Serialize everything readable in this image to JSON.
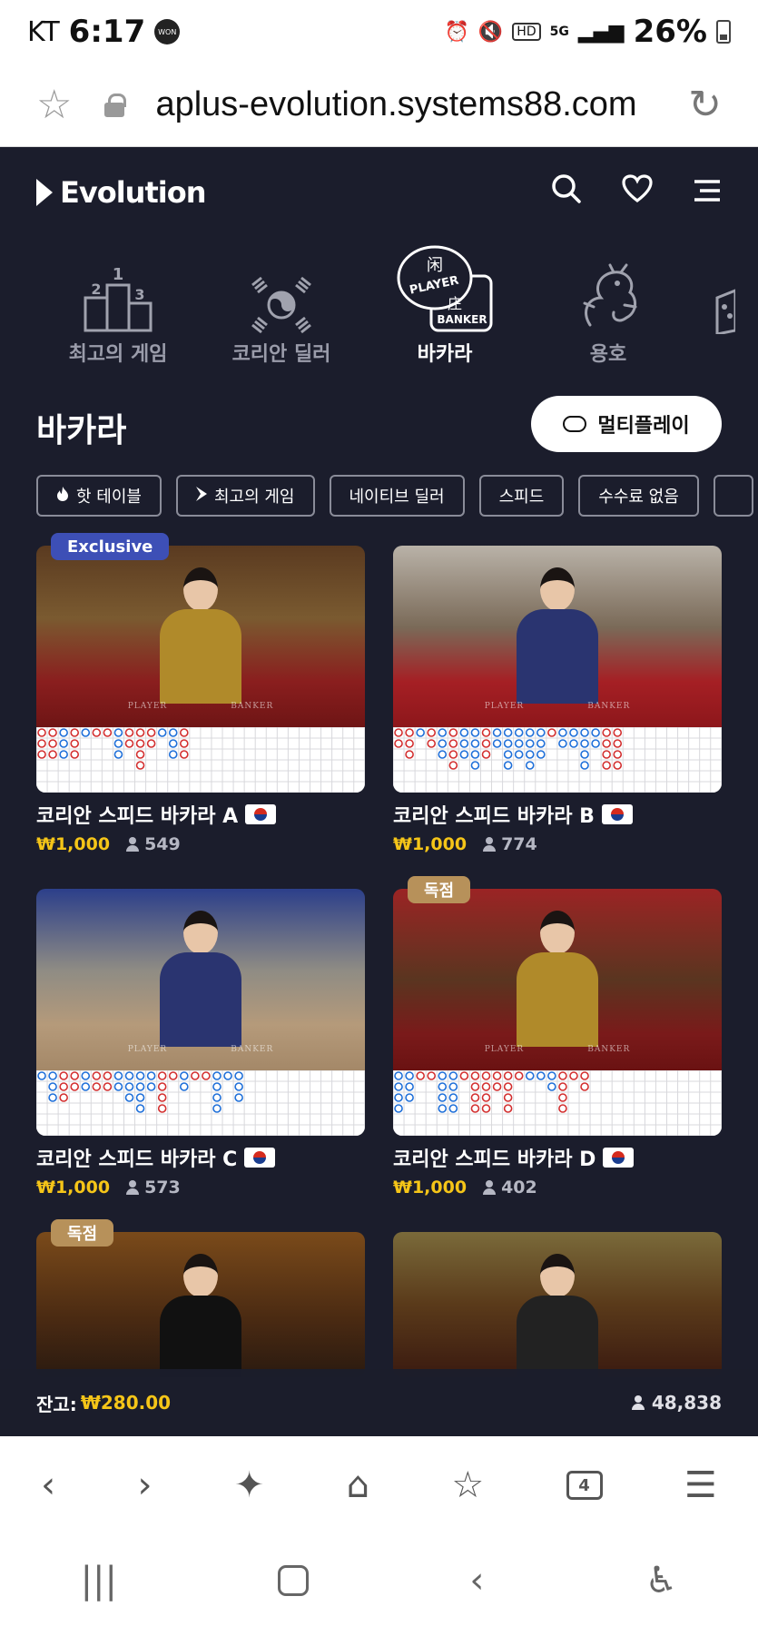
{
  "status_bar": {
    "carrier": "KT",
    "time": "6:17",
    "won_label": "WON",
    "battery": "26%"
  },
  "browser": {
    "url": "aplus-evolution.systems88.com",
    "tab_count": "4"
  },
  "app": {
    "logo": "Evolution"
  },
  "categories": [
    {
      "label": "최고의 게임",
      "icon": "podium-icon"
    },
    {
      "label": "코리안 딜러",
      "icon": "korea-flag-icon"
    },
    {
      "label": "바카라",
      "icon": "baccarat-icon",
      "icon_text_top": "闲",
      "icon_text_player": "PLAYER",
      "icon_text_banker": "BANKER",
      "icon_text_bottom": "庄"
    },
    {
      "label": "용호",
      "icon": "dragon-icon"
    }
  ],
  "section": {
    "title": "바카라",
    "multiplay_label": "멀티플레이"
  },
  "filters": [
    {
      "label": "핫 테이블",
      "icon": "flame-icon"
    },
    {
      "label": "최고의 게임",
      "icon": "evolution-icon"
    },
    {
      "label": "네이티브 딜러"
    },
    {
      "label": "스피드"
    },
    {
      "label": "수수료 없음"
    }
  ],
  "games": [
    {
      "name": "코리안 스피드 바카라 A",
      "min_bet": "₩1,000",
      "players": "549",
      "badge": "Exclusive",
      "table_player": "PLAYER",
      "table_banker": "BANKER"
    },
    {
      "name": "코리안 스피드 바카라 B",
      "min_bet": "₩1,000",
      "players": "774",
      "badge": "",
      "table_player": "PLAYER",
      "table_banker": "BANKER"
    },
    {
      "name": "코리안 스피드 바카라 C",
      "min_bet": "₩1,000",
      "players": "573",
      "badge": "",
      "table_player": "PLAYER",
      "table_banker": "BANKER"
    },
    {
      "name": "코리안 스피드 바카라 D",
      "min_bet": "₩1,000",
      "players": "402",
      "badge": "독점",
      "table_player": "PLAYER",
      "table_banker": "BANKER"
    },
    {
      "name": "",
      "badge": "독점"
    },
    {
      "name": "",
      "badge": ""
    }
  ],
  "balance": {
    "label": "잔고:",
    "amount": "₩280.00",
    "online_count": "48,838"
  },
  "colors": {
    "background": "#1b1d2c",
    "accent_gold": "#f5c518",
    "exclusive_badge": "#3d4fb6",
    "dokjeom_badge": "#b7915a",
    "banker_red": "#d32f2f",
    "player_blue": "#1e6fd9"
  }
}
